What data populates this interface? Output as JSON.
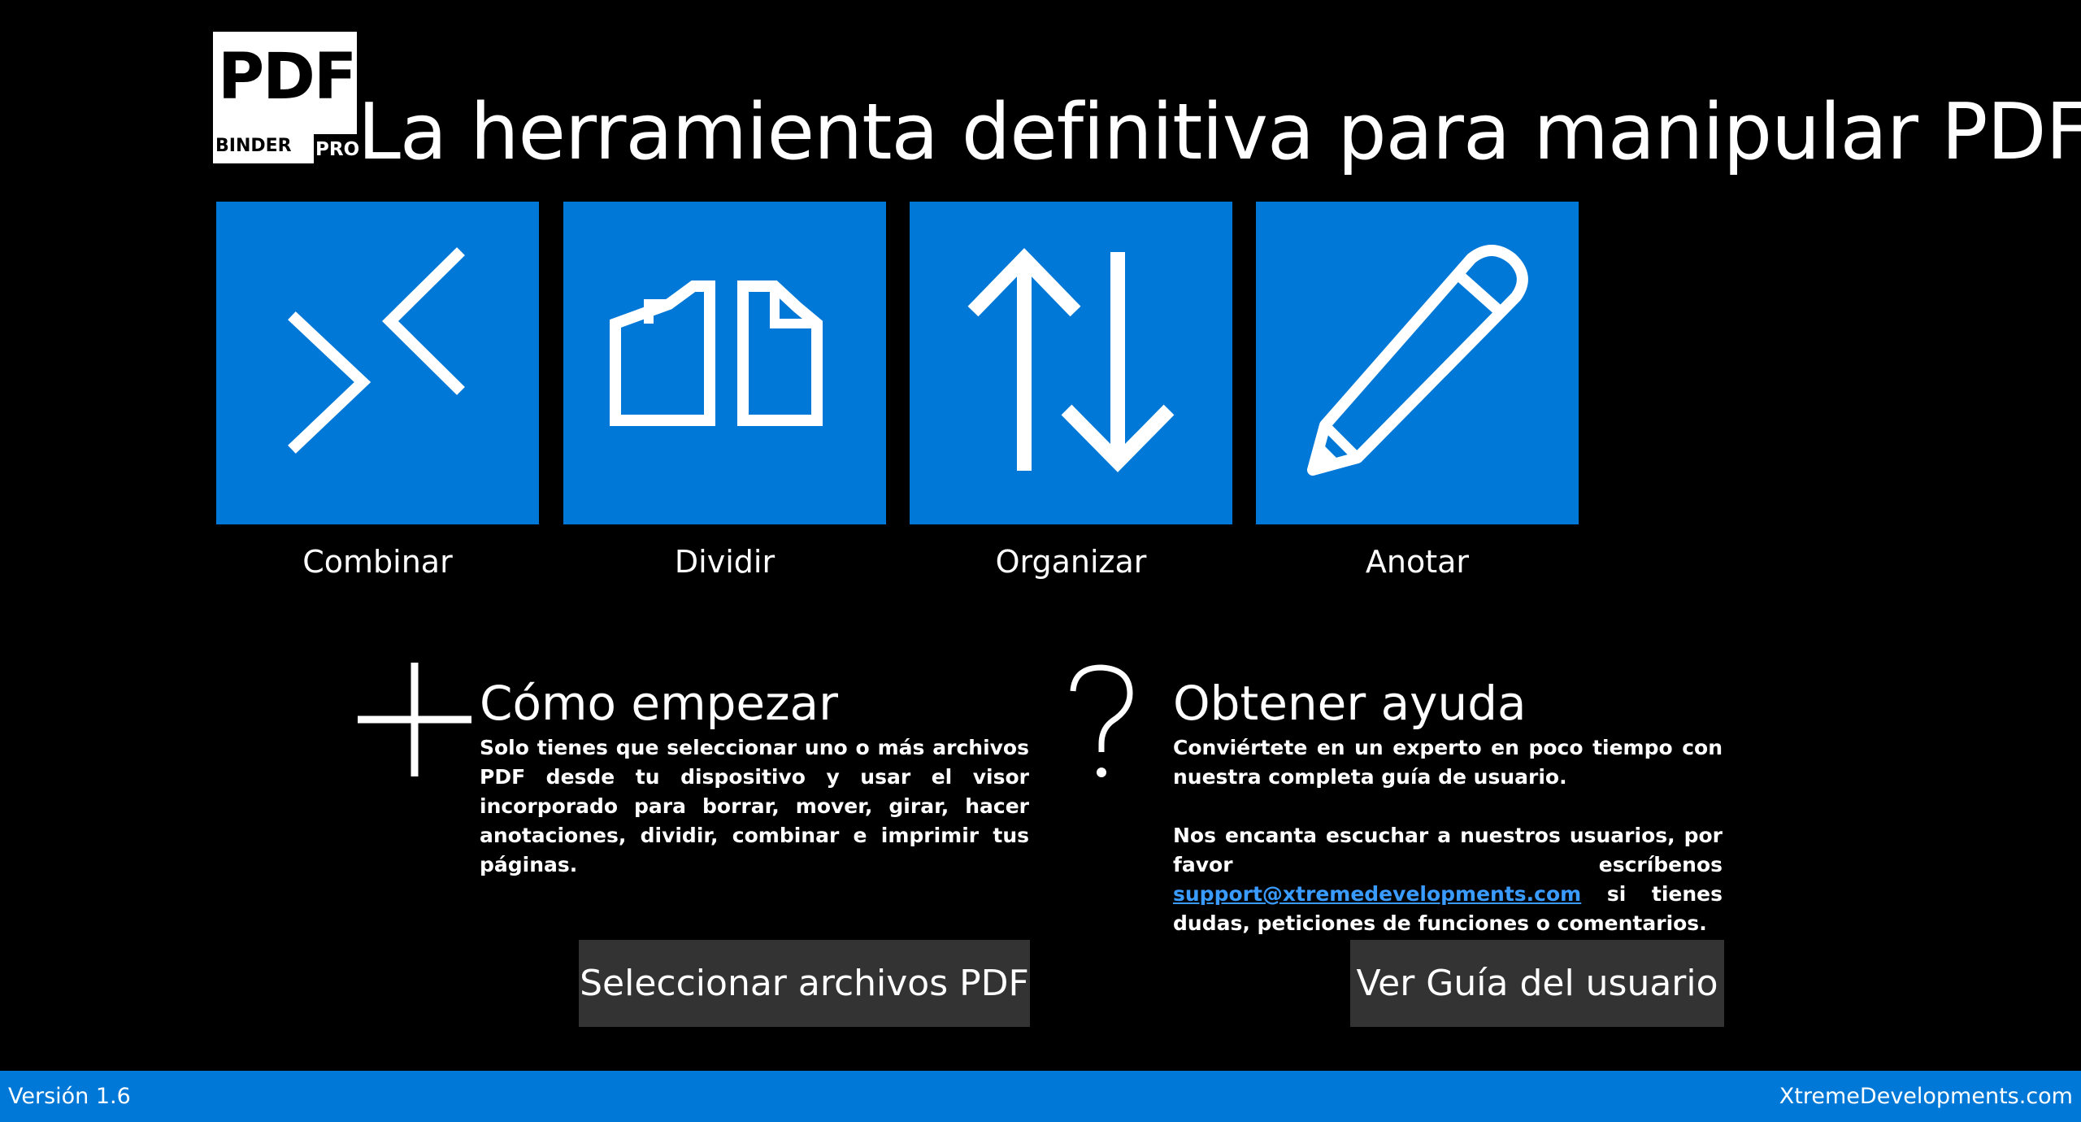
{
  "logo": {
    "word": "PDF",
    "binder": "BINDER",
    "pro": "PRO"
  },
  "header": {
    "title": "La herramienta definitiva para manipular PDF"
  },
  "tiles": [
    {
      "label": "Combinar",
      "icon": "merge-icon"
    },
    {
      "label": "Dividir",
      "icon": "split-pages-icon"
    },
    {
      "label": "Organizar",
      "icon": "sort-arrows-icon"
    },
    {
      "label": "Anotar",
      "icon": "pencil-icon"
    }
  ],
  "getting_started": {
    "icon": "plus-icon",
    "title": "Cómo empezar",
    "text": "Solo tienes que seleccionar uno o más archivos PDF desde tu dispositivo y usar el visor incorporado para borrar, mover, girar, hacer anotaciones, dividir, combinar e imprimir tus páginas.",
    "button_label": "Seleccionar archivos PDF"
  },
  "help": {
    "icon": "question-mark-icon",
    "title": "Obtener ayuda",
    "text1": "Conviértete en un experto en poco tiempo con nuestra completa guía de usuario.",
    "text2_before": "Nos encanta escuchar a nuestros usuarios, por favor escríbenos",
    "email": "support@xtremedevelopments.com",
    "text2_after": "si tienes dudas, peticiones de funciones o comentarios.",
    "button_label": "Ver Guía del usuario"
  },
  "status_bar": {
    "version": "Versión 1.6",
    "company": "XtremeDevelopments.com"
  },
  "colors": {
    "accent": "#0078d7",
    "background": "#000000",
    "button": "#333333",
    "link": "#3a9bff"
  }
}
